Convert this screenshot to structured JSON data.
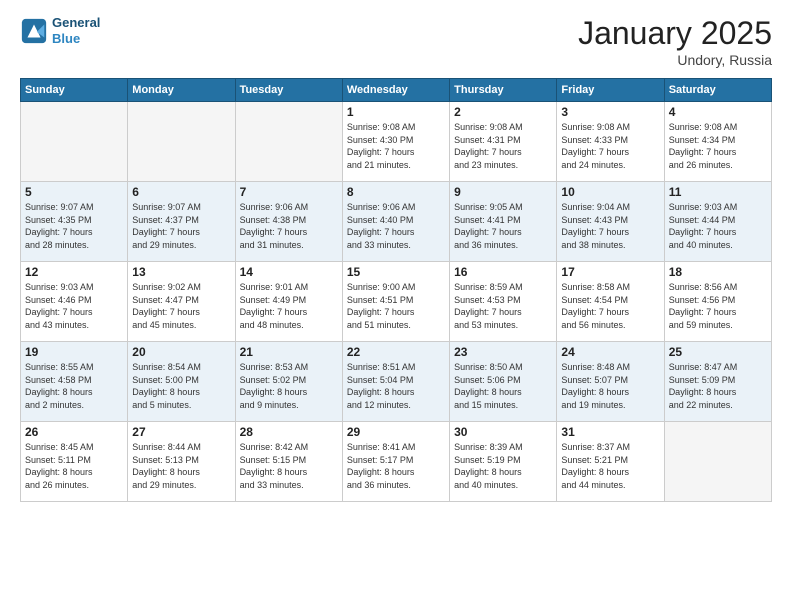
{
  "header": {
    "logo_line1": "General",
    "logo_line2": "Blue",
    "month": "January 2025",
    "location": "Undory, Russia"
  },
  "weekdays": [
    "Sunday",
    "Monday",
    "Tuesday",
    "Wednesday",
    "Thursday",
    "Friday",
    "Saturday"
  ],
  "weeks": [
    [
      {
        "day": "",
        "content": ""
      },
      {
        "day": "",
        "content": ""
      },
      {
        "day": "",
        "content": ""
      },
      {
        "day": "1",
        "content": "Sunrise: 9:08 AM\nSunset: 4:30 PM\nDaylight: 7 hours\nand 21 minutes."
      },
      {
        "day": "2",
        "content": "Sunrise: 9:08 AM\nSunset: 4:31 PM\nDaylight: 7 hours\nand 23 minutes."
      },
      {
        "day": "3",
        "content": "Sunrise: 9:08 AM\nSunset: 4:33 PM\nDaylight: 7 hours\nand 24 minutes."
      },
      {
        "day": "4",
        "content": "Sunrise: 9:08 AM\nSunset: 4:34 PM\nDaylight: 7 hours\nand 26 minutes."
      }
    ],
    [
      {
        "day": "5",
        "content": "Sunrise: 9:07 AM\nSunset: 4:35 PM\nDaylight: 7 hours\nand 28 minutes."
      },
      {
        "day": "6",
        "content": "Sunrise: 9:07 AM\nSunset: 4:37 PM\nDaylight: 7 hours\nand 29 minutes."
      },
      {
        "day": "7",
        "content": "Sunrise: 9:06 AM\nSunset: 4:38 PM\nDaylight: 7 hours\nand 31 minutes."
      },
      {
        "day": "8",
        "content": "Sunrise: 9:06 AM\nSunset: 4:40 PM\nDaylight: 7 hours\nand 33 minutes."
      },
      {
        "day": "9",
        "content": "Sunrise: 9:05 AM\nSunset: 4:41 PM\nDaylight: 7 hours\nand 36 minutes."
      },
      {
        "day": "10",
        "content": "Sunrise: 9:04 AM\nSunset: 4:43 PM\nDaylight: 7 hours\nand 38 minutes."
      },
      {
        "day": "11",
        "content": "Sunrise: 9:03 AM\nSunset: 4:44 PM\nDaylight: 7 hours\nand 40 minutes."
      }
    ],
    [
      {
        "day": "12",
        "content": "Sunrise: 9:03 AM\nSunset: 4:46 PM\nDaylight: 7 hours\nand 43 minutes."
      },
      {
        "day": "13",
        "content": "Sunrise: 9:02 AM\nSunset: 4:47 PM\nDaylight: 7 hours\nand 45 minutes."
      },
      {
        "day": "14",
        "content": "Sunrise: 9:01 AM\nSunset: 4:49 PM\nDaylight: 7 hours\nand 48 minutes."
      },
      {
        "day": "15",
        "content": "Sunrise: 9:00 AM\nSunset: 4:51 PM\nDaylight: 7 hours\nand 51 minutes."
      },
      {
        "day": "16",
        "content": "Sunrise: 8:59 AM\nSunset: 4:53 PM\nDaylight: 7 hours\nand 53 minutes."
      },
      {
        "day": "17",
        "content": "Sunrise: 8:58 AM\nSunset: 4:54 PM\nDaylight: 7 hours\nand 56 minutes."
      },
      {
        "day": "18",
        "content": "Sunrise: 8:56 AM\nSunset: 4:56 PM\nDaylight: 7 hours\nand 59 minutes."
      }
    ],
    [
      {
        "day": "19",
        "content": "Sunrise: 8:55 AM\nSunset: 4:58 PM\nDaylight: 8 hours\nand 2 minutes."
      },
      {
        "day": "20",
        "content": "Sunrise: 8:54 AM\nSunset: 5:00 PM\nDaylight: 8 hours\nand 5 minutes."
      },
      {
        "day": "21",
        "content": "Sunrise: 8:53 AM\nSunset: 5:02 PM\nDaylight: 8 hours\nand 9 minutes."
      },
      {
        "day": "22",
        "content": "Sunrise: 8:51 AM\nSunset: 5:04 PM\nDaylight: 8 hours\nand 12 minutes."
      },
      {
        "day": "23",
        "content": "Sunrise: 8:50 AM\nSunset: 5:06 PM\nDaylight: 8 hours\nand 15 minutes."
      },
      {
        "day": "24",
        "content": "Sunrise: 8:48 AM\nSunset: 5:07 PM\nDaylight: 8 hours\nand 19 minutes."
      },
      {
        "day": "25",
        "content": "Sunrise: 8:47 AM\nSunset: 5:09 PM\nDaylight: 8 hours\nand 22 minutes."
      }
    ],
    [
      {
        "day": "26",
        "content": "Sunrise: 8:45 AM\nSunset: 5:11 PM\nDaylight: 8 hours\nand 26 minutes."
      },
      {
        "day": "27",
        "content": "Sunrise: 8:44 AM\nSunset: 5:13 PM\nDaylight: 8 hours\nand 29 minutes."
      },
      {
        "day": "28",
        "content": "Sunrise: 8:42 AM\nSunset: 5:15 PM\nDaylight: 8 hours\nand 33 minutes."
      },
      {
        "day": "29",
        "content": "Sunrise: 8:41 AM\nSunset: 5:17 PM\nDaylight: 8 hours\nand 36 minutes."
      },
      {
        "day": "30",
        "content": "Sunrise: 8:39 AM\nSunset: 5:19 PM\nDaylight: 8 hours\nand 40 minutes."
      },
      {
        "day": "31",
        "content": "Sunrise: 8:37 AM\nSunset: 5:21 PM\nDaylight: 8 hours\nand 44 minutes."
      },
      {
        "day": "",
        "content": ""
      }
    ]
  ]
}
